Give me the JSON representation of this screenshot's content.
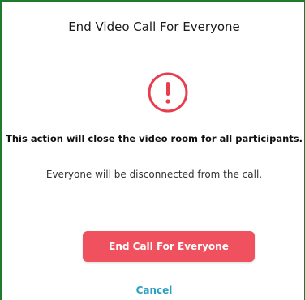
{
  "dialog": {
    "title": "End Video Call For Everyone",
    "icon": "warning-circle-icon",
    "headline": "This action will close the video room for all participants.",
    "subtext": "Everyone will be disconnected from the call.",
    "confirm_label": "End Call For Everyone",
    "cancel_label": "Cancel"
  },
  "colors": {
    "accent_red": "#f0515f",
    "cancel_blue": "#2aa1c2",
    "frame_green": "#1f7a2e",
    "icon_red": "#e83d4d"
  }
}
